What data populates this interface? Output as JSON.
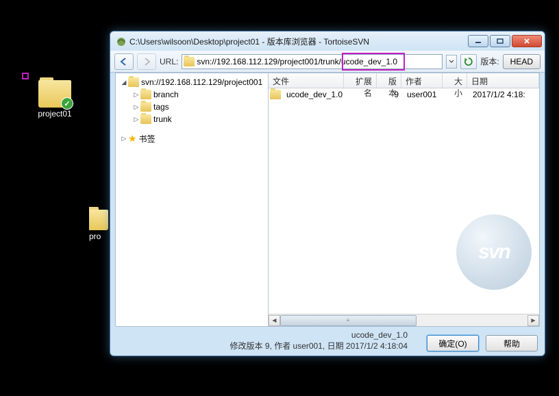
{
  "desktop": {
    "icon1_label": "project01",
    "icon2_label": "pro"
  },
  "window": {
    "title": "C:\\Users\\wilsoon\\Desktop\\project01 - 版本库浏览器 - TortoiseSVN"
  },
  "toolbar": {
    "url_label": "URL:",
    "url_value": "svn://192.168.112.129/project001/trunk/ucode_dev_1.0",
    "version_label": "版本:",
    "head_label": "HEAD"
  },
  "tree": {
    "root": "svn://192.168.112.129/project001",
    "items": [
      "branch",
      "tags",
      "trunk"
    ],
    "bookmarks": "书签"
  },
  "columns": {
    "file": "文件",
    "ext": "扩展名",
    "rev": "版本",
    "author": "作者",
    "size": "大小",
    "date": "日期"
  },
  "rows": [
    {
      "name": "ucode_dev_1.0",
      "ext": "",
      "rev": "9",
      "author": "user001",
      "size": "",
      "date": "2017/1/2 4:18:"
    }
  ],
  "logo": "svn",
  "status": {
    "line1": "ucode_dev_1.0",
    "line2": "修改版本 9, 作者 user001, 日期 2017/1/2 4:18:04"
  },
  "buttons": {
    "ok": "确定(O)",
    "help": "帮助"
  }
}
